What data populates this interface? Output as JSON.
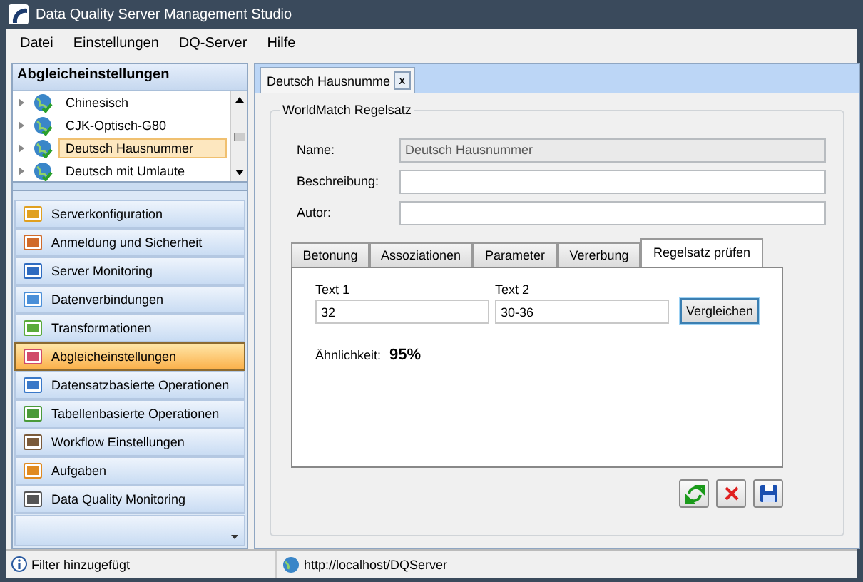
{
  "window": {
    "title": "Data Quality Server Management Studio"
  },
  "menu": [
    "Datei",
    "Einstellungen",
    "DQ-Server",
    "Hilfe"
  ],
  "sidebar": {
    "title": "Abgleicheinstellungen",
    "tree": [
      {
        "label": "Chinesisch",
        "selected": false
      },
      {
        "label": "CJK-Optisch-G80",
        "selected": false
      },
      {
        "label": "Deutsch Hausnummer",
        "selected": true
      },
      {
        "label": "Deutsch mit Umlaute",
        "selected": false
      }
    ],
    "nav": [
      {
        "label": "Serverkonfiguration",
        "selected": false
      },
      {
        "label": "Anmeldung und Sicherheit",
        "selected": false
      },
      {
        "label": "Server Monitoring",
        "selected": false
      },
      {
        "label": "Datenverbindungen",
        "selected": false
      },
      {
        "label": "Transformationen",
        "selected": false
      },
      {
        "label": "Abgleicheinstellungen",
        "selected": true
      },
      {
        "label": "Datensatzbasierte Operationen",
        "selected": false
      },
      {
        "label": "Tabellenbasierte Operationen",
        "selected": false
      },
      {
        "label": "Workflow Einstellungen",
        "selected": false
      },
      {
        "label": "Aufgaben",
        "selected": false
      },
      {
        "label": "Data Quality Monitoring",
        "selected": false
      }
    ]
  },
  "document_tab": {
    "label": "Deutsch Hausnumme",
    "close": "x"
  },
  "group": {
    "title": "WorldMatch Regelsatz",
    "fields": [
      {
        "label": "Name:",
        "value": "Deutsch Hausnummer",
        "disabled": true
      },
      {
        "label": "Beschreibung:",
        "disabled": false
      },
      {
        "label": "Autor:",
        "disabled": false
      }
    ]
  },
  "tabs": [
    {
      "label": "Betonung",
      "selected": false
    },
    {
      "label": "Assoziationen",
      "selected": false
    },
    {
      "label": "Parameter",
      "selected": false
    },
    {
      "label": "Vererbung",
      "selected": false
    },
    {
      "label": "Regelsatz prüfen",
      "selected": true
    }
  ],
  "compare": {
    "text1_label": "Text 1",
    "text1": "32",
    "text2_label": "Text 2",
    "text2": "30-36",
    "button": "Vergleichen",
    "result_label": "Ähnlichkeit:",
    "result": "95%"
  },
  "status_bar": {
    "message": "Filter hinzugefügt",
    "url": "http://localhost/DQServer"
  }
}
